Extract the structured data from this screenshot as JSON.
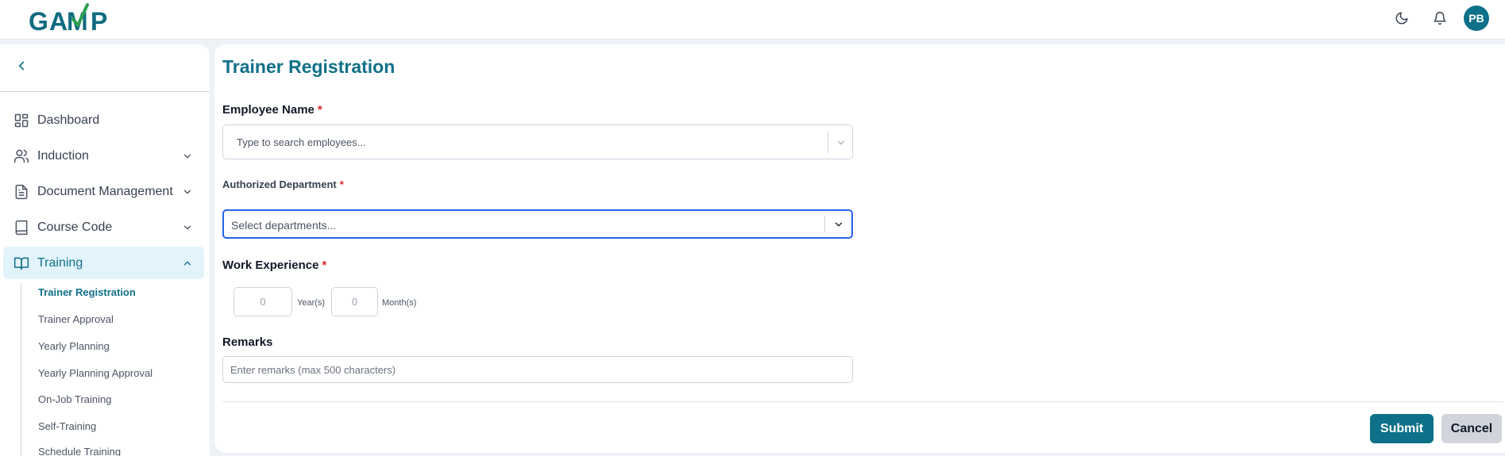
{
  "app": {
    "logo_text": "GAMP"
  },
  "header": {
    "avatar_initials": "PB",
    "theme_icon": "moon-icon",
    "notification_icon": "bell-icon"
  },
  "sidebar": {
    "items": [
      {
        "label": "Dashboard",
        "icon": "grid-icon"
      },
      {
        "label": "Induction",
        "icon": "users-icon"
      },
      {
        "label": "Document Management",
        "icon": "document-icon"
      },
      {
        "label": "Course Code",
        "icon": "book-icon"
      },
      {
        "label": "Training",
        "icon": "open-book-icon"
      }
    ],
    "training_subitems": [
      "Trainer Registration",
      "Trainer Approval",
      "Yearly Planning",
      "Yearly Planning Approval",
      "On-Job Training",
      "Self-Training",
      "Schedule Training"
    ]
  },
  "form": {
    "title": "Trainer Registration",
    "employee_label": "Employee Name",
    "employee_placeholder": "Type to search employees...",
    "department_label": "Authorized Department",
    "department_placeholder": "Select departments...",
    "experience_label": "Work Experience",
    "years_value": "0",
    "years_unit": "Year(s)",
    "months_value": "0",
    "months_unit": "Month(s)",
    "remarks_label": "Remarks",
    "remarks_placeholder": "Enter remarks (max 500 characters)",
    "required_mark": "*",
    "submit_label": "Submit",
    "cancel_label": "Cancel"
  },
  "colors": {
    "brand": "#0f7089",
    "active_bg": "#e3f3fb",
    "required": "#dc2626",
    "focus": "#2563eb"
  }
}
